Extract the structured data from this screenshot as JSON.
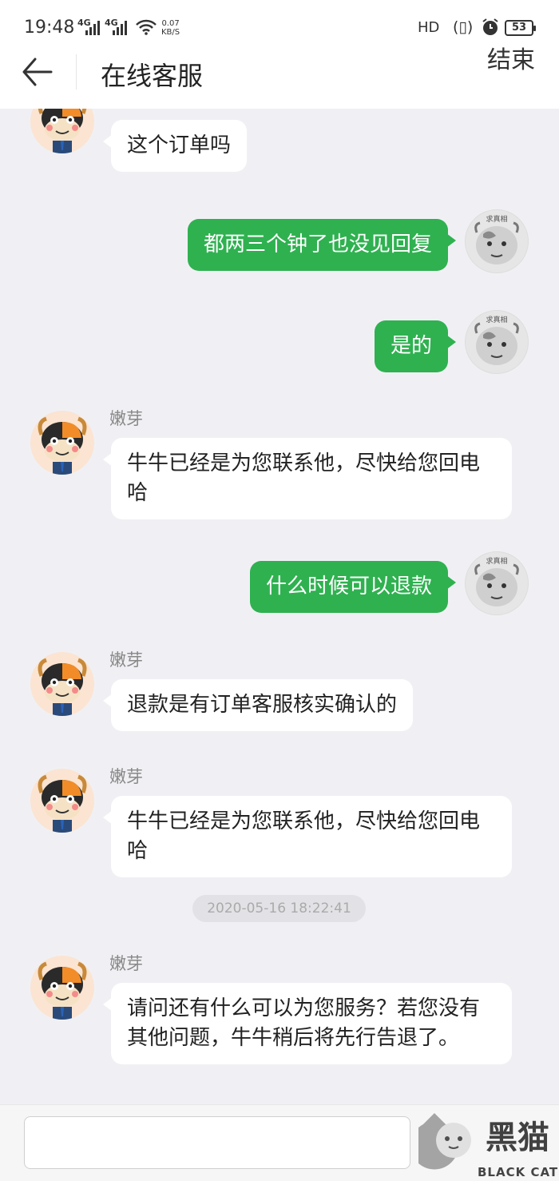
{
  "status_bar": {
    "time": "19:48",
    "signal1": "4G",
    "signal2": "4G",
    "net_speed_value": "0.07",
    "net_speed_unit": "KB/S",
    "hd": "HD",
    "battery": "53"
  },
  "header": {
    "title": "在线客服",
    "end_label": "结束"
  },
  "chat": {
    "messages": [
      {
        "side": "agent",
        "text": "这个订单吗"
      },
      {
        "side": "user",
        "text": "都两三个钟了也没见回复"
      },
      {
        "side": "user",
        "text": "是的"
      },
      {
        "side": "agent",
        "name": "嫩芽",
        "text": "牛牛已经是为您联系他，尽快给您回电哈"
      },
      {
        "side": "user",
        "text": "什么时候可以退款"
      },
      {
        "side": "agent",
        "name": "嫩芽",
        "text": "退款是有订单客服核实确认的"
      },
      {
        "side": "agent",
        "name": "嫩芽",
        "text": "牛牛已经是为您联系他，尽快给您回电哈"
      },
      {
        "side": "agent",
        "name": "嫩芽",
        "text": "请问还有什么可以为您服务？若您没有其他问题，牛牛稍后将先行告退了。"
      }
    ],
    "timestamp": "2020-05-16 18:22:41",
    "user_avatar_label": "求真相"
  },
  "input": {
    "value": "",
    "placeholder": ""
  },
  "watermark": {
    "text": "BLACK CAT",
    "logo_text": "黑猫"
  },
  "icons": {
    "back": "arrow-left-icon",
    "agent_avatar": "cow-mascot-icon",
    "user_avatar": "cartoon-cow-icon"
  },
  "colors": {
    "user_bubble": "#2fb150",
    "agent_bubble": "#ffffff",
    "chat_background": "#f0f0f4"
  }
}
